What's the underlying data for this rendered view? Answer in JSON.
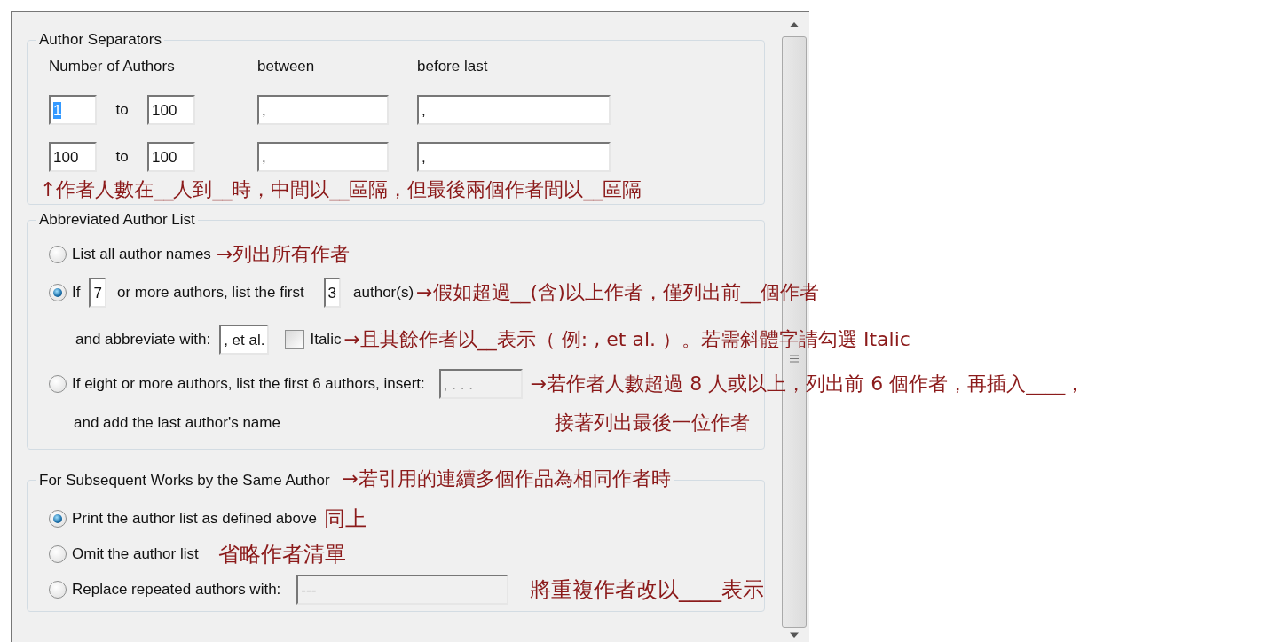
{
  "author_separators": {
    "title": "Author Separators",
    "headers": [
      "Number of Authors",
      "between",
      "before last"
    ],
    "rows": [
      {
        "from": "1",
        "from_highlighted": true,
        "to_label": "to",
        "to": "100",
        "between": ",",
        "before_last": ","
      },
      {
        "from": "100",
        "from_highlighted": false,
        "to_label": "to",
        "to": "100",
        "between": ",",
        "before_last": ","
      }
    ],
    "note": "↑作者人數在__人到__時，中間以__區隔，但最後兩個作者間以__區隔"
  },
  "abbreviated_author_list": {
    "title": "Abbreviated Author List",
    "options": [
      {
        "kind": "simple",
        "selected": false,
        "label": "List all author names",
        "note": "→列出所有作者"
      },
      {
        "kind": "threshold",
        "selected": true,
        "prefix": "If",
        "min": "7",
        "middle": "or more authors, list the first",
        "first": "3",
        "suffix": "author(s)",
        "note": "→假如超過__(含)以上作者，僅列出前__個作者",
        "abbreviate": {
          "label": "and abbreviate with:",
          "value": ", et al.",
          "italic": {
            "label": "Italic",
            "checked": false
          },
          "note": "→且其餘作者以__表示（ 例: , et al. ）。若需斜體字請勾選 Italic"
        }
      },
      {
        "kind": "insert",
        "selected": false,
        "label": "If eight or more authors, list the first 6 authors, insert:",
        "value": ", . . .",
        "disabled": true,
        "line2": "and add the last author's name",
        "note_lines": [
          "→若作者人數超過 8 人或以上，列出前 6 個作者，再插入____，",
          "接著列出最後一位作者"
        ]
      }
    ]
  },
  "subsequent_works": {
    "title": "For Subsequent Works by the Same Author",
    "note": "→若引用的連續多個作品為相同作者時",
    "options": [
      {
        "kind": "simple",
        "selected": true,
        "label": "Print the author list as defined above",
        "note": "同上"
      },
      {
        "kind": "simple",
        "selected": false,
        "label": "Omit the author list",
        "note": "省略作者清單"
      },
      {
        "kind": "field",
        "selected": false,
        "label": "Replace repeated authors with:",
        "value": "---",
        "disabled": true,
        "note": "將重複作者改以____表示"
      }
    ]
  }
}
